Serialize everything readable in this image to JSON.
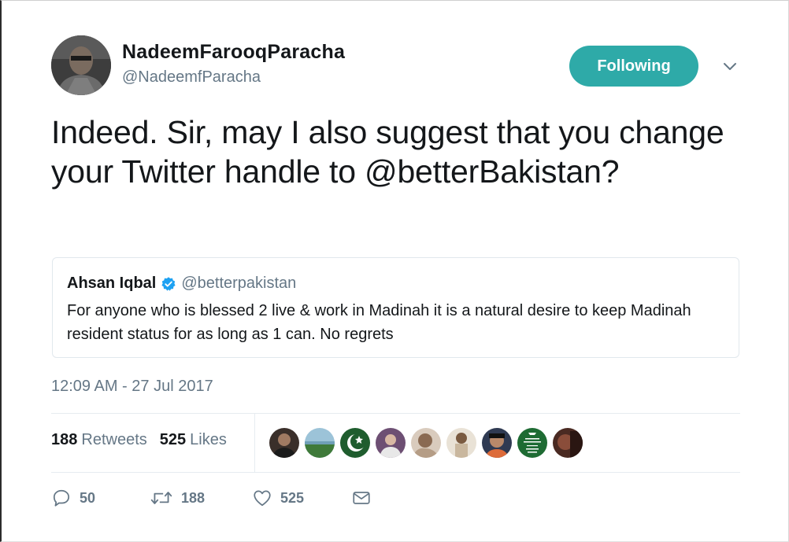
{
  "author": {
    "display_name": "NadeemFarooqParacha",
    "handle": "@NadeemfParacha",
    "avatar_icon": "profile-photo"
  },
  "follow_button": {
    "label": "Following",
    "color": "#2eaaa8"
  },
  "tweet": {
    "text": "Indeed. Sir, may I also suggest that you change your Twitter handle to @betterBakistan?",
    "timestamp": "12:09 AM - 27 Jul 2017"
  },
  "quoted_tweet": {
    "name": "Ahsan Iqbal",
    "verified": true,
    "handle": "@betterpakistan",
    "text": "For anyone who is blessed 2 live & work in Madinah it is a natural desire to keep Madinah resident status for as long as 1 can. No regrets"
  },
  "stats": {
    "retweets_count": "188",
    "retweets_label": "Retweets",
    "likes_count": "525",
    "likes_label": "Likes"
  },
  "liker_avatars": [
    {
      "name": "liker-avatar-1",
      "color": "#3a2f2a"
    },
    {
      "name": "liker-avatar-2",
      "color": "#6f9fb7"
    },
    {
      "name": "liker-avatar-3",
      "color": "#1f5d2e"
    },
    {
      "name": "liker-avatar-4",
      "color": "#6d4f73"
    },
    {
      "name": "liker-avatar-5",
      "color": "#b59d86"
    },
    {
      "name": "liker-avatar-6",
      "color": "#c9b79e"
    },
    {
      "name": "liker-avatar-7",
      "color": "#2f3a52"
    },
    {
      "name": "liker-avatar-8",
      "color": "#1e6b33",
      "text": "I'M PAKISTANI KEEP CALM"
    },
    {
      "name": "liker-avatar-9",
      "color": "#4a2a22"
    }
  ],
  "actions": {
    "reply_count": "50",
    "retweet_count": "188",
    "like_count": "525"
  },
  "colors": {
    "text_primary": "#14171a",
    "text_secondary": "#657786",
    "verified_blue": "#1da1f2",
    "border": "#e1e8ed"
  }
}
